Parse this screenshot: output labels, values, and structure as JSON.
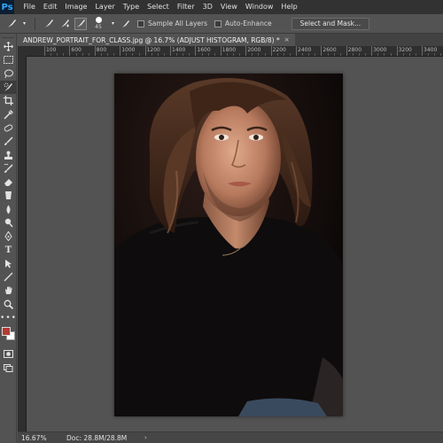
{
  "app": {
    "logo": "Ps"
  },
  "menu": [
    "File",
    "Edit",
    "Image",
    "Layer",
    "Type",
    "Select",
    "Filter",
    "3D",
    "View",
    "Window",
    "Help"
  ],
  "options": {
    "brush_size": "45",
    "sample_all_layers": "Sample All Layers",
    "auto_enhance": "Auto-Enhance",
    "select_mask": "Select and Mask..."
  },
  "document": {
    "tab_title": "ANDREW_PORTRAIT_FOR_CLASS.jpg @ 16.7% (ADJUST HISTOGRAM, RGB/8) *",
    "close": "×"
  },
  "ruler": {
    "labels": [
      "100",
      "600",
      "800",
      "1000",
      "1200",
      "1400",
      "1600",
      "1800",
      "2000",
      "2200",
      "2400",
      "2600",
      "2800",
      "3000",
      "3200",
      "3400"
    ]
  },
  "status": {
    "zoom": "16.67%",
    "doc": "Doc: 28.8M/28.8M",
    "arrow": "›"
  },
  "colors": {
    "foreground": "#b53a34",
    "background": "#ffffff",
    "accent": "#31a8ff"
  },
  "tools": [
    "move-tool-icon",
    "marquee-tool-icon",
    "lasso-tool-icon",
    "quick-selection-tool-icon",
    "crop-tool-icon",
    "eyedropper-tool-icon",
    "healing-brush-tool-icon",
    "brush-tool-icon",
    "clone-stamp-tool-icon",
    "history-brush-tool-icon",
    "eraser-tool-icon",
    "gradient-tool-icon",
    "blur-tool-icon",
    "dodge-tool-icon",
    "pen-tool-icon",
    "type-tool-icon",
    "path-selection-tool-icon",
    "line-tool-icon",
    "hand-tool-icon",
    "zoom-tool-icon",
    "more-tools-icon"
  ]
}
